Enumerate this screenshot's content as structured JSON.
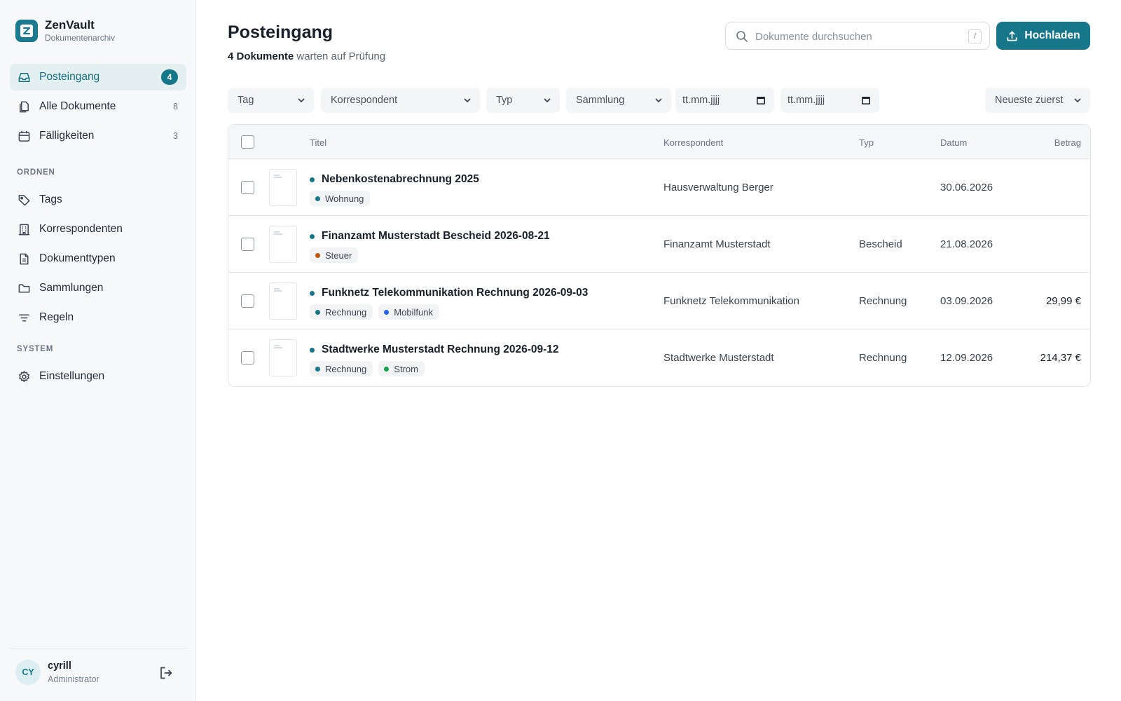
{
  "brand": {
    "name": "ZenVault",
    "subtitle": "Dokumentenarchiv",
    "logo_letter": "Z"
  },
  "nav": {
    "main": [
      {
        "label": "Posteingang",
        "count": "4",
        "active": true,
        "icon": "inbox-icon"
      },
      {
        "label": "Alle Dokumente",
        "count": "8",
        "icon": "documents-icon"
      },
      {
        "label": "Fälligkeiten",
        "count": "3",
        "icon": "calendar-icon"
      }
    ],
    "organize_heading": "ORDNEN",
    "organize": [
      {
        "label": "Tags",
        "icon": "tag-icon"
      },
      {
        "label": "Korrespondenten",
        "icon": "building-icon"
      },
      {
        "label": "Dokumenttypen",
        "icon": "file-text-icon"
      },
      {
        "label": "Sammlungen",
        "icon": "folder-icon"
      },
      {
        "label": "Regeln",
        "icon": "filter-icon"
      }
    ],
    "system_heading": "SYSTEM",
    "system": [
      {
        "label": "Einstellungen",
        "icon": "gear-icon"
      }
    ]
  },
  "user": {
    "initials": "CY",
    "name": "cyrill",
    "role": "Administrator"
  },
  "header": {
    "title": "Posteingang",
    "subtitle_count": "4 Dokumente",
    "subtitle_rest": " warten auf Prüfung"
  },
  "search": {
    "placeholder": "Dokumente durchsuchen",
    "shortcut": "/"
  },
  "upload_label": "Hochladen",
  "filters": {
    "tag": "Tag",
    "correspondent": "Korrespondent",
    "type": "Typ",
    "collection": "Sammlung",
    "date_from": "tt.mm.jjjj",
    "date_to": "tt.mm.jjjj",
    "sort": "Neueste zuerst"
  },
  "table": {
    "headers": {
      "title": "Titel",
      "correspondent": "Korrespondent",
      "type": "Typ",
      "date": "Datum",
      "amount": "Betrag"
    },
    "rows": [
      {
        "title": "Nebenkostenabrechnung 2025",
        "tags": [
          {
            "label": "Wohnung",
            "color": "#17778a"
          }
        ],
        "correspondent": "Hausverwaltung Berger",
        "type": "",
        "date": "30.06.2026",
        "amount": ""
      },
      {
        "title": "Finanzamt Musterstadt Bescheid 2026-08-21",
        "tags": [
          {
            "label": "Steuer",
            "color": "#c2570c"
          }
        ],
        "correspondent": "Finanzamt Musterstadt",
        "type": "Bescheid",
        "date": "21.08.2026",
        "amount": ""
      },
      {
        "title": "Funknetz Telekommunikation Rechnung 2026-09-03",
        "tags": [
          {
            "label": "Rechnung",
            "color": "#17778a"
          },
          {
            "label": "Mobilfunk",
            "color": "#2563eb"
          }
        ],
        "correspondent": "Funknetz Telekommunikation",
        "type": "Rechnung",
        "date": "03.09.2026",
        "amount": "29,99 €"
      },
      {
        "title": "Stadtwerke Musterstadt Rechnung 2026-09-12",
        "tags": [
          {
            "label": "Rechnung",
            "color": "#17778a"
          },
          {
            "label": "Strom",
            "color": "#16a34a"
          }
        ],
        "correspondent": "Stadtwerke Musterstadt",
        "type": "Rechnung",
        "date": "12.09.2026",
        "amount": "214,37 €"
      }
    ]
  },
  "colors": {
    "accent": "#17778a",
    "accent_light": "#e3eff1",
    "sidebar_bg": "#f6f8fa"
  }
}
